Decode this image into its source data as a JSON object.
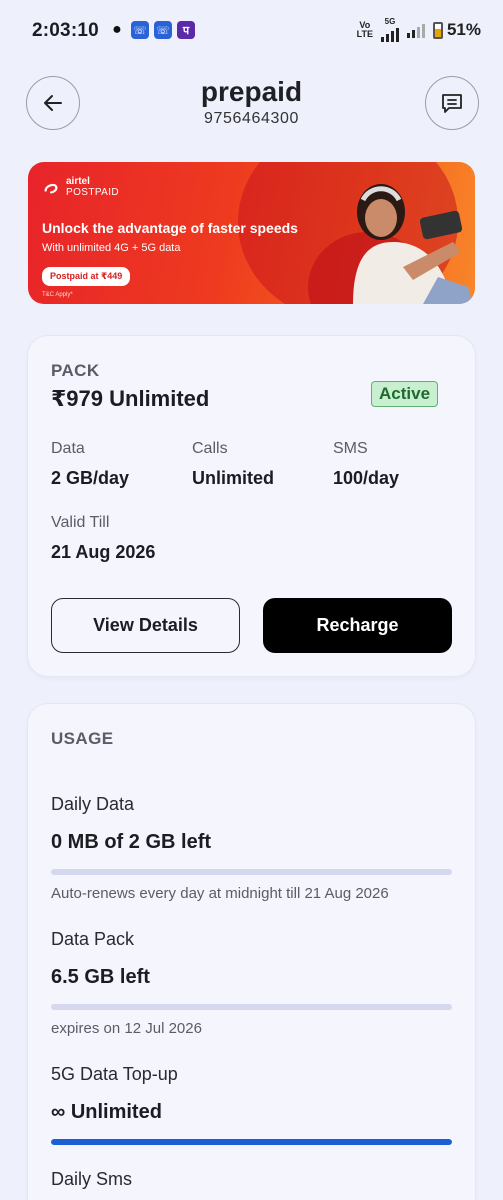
{
  "status_bar": {
    "time": "2:03:10",
    "volte": "Vo\nLTE",
    "network": "5G",
    "battery_percent": "51%",
    "battery_level": 0.51
  },
  "header": {
    "title": "prepaid",
    "number": "9756464300"
  },
  "banner": {
    "brand": "airtel",
    "brand_sub": "POSTPAID",
    "headline": "Unlock the advantage of faster speeds",
    "subline": "With unlimited 4G + 5G data",
    "pill": "Postpaid at ₹449",
    "tc": "T&C Apply*"
  },
  "pack": {
    "caption": "PACK",
    "name": "₹979 Unlimited",
    "status": "Active",
    "data_label": "Data",
    "data_value": "2 GB/day",
    "calls_label": "Calls",
    "calls_value": "Unlimited",
    "sms_label": "SMS",
    "sms_value": "100/day",
    "valid_label": "Valid Till",
    "valid_value": "21 Aug 2026",
    "view_details": "View Details",
    "recharge": "Recharge"
  },
  "usage": {
    "caption": "USAGE",
    "items": [
      {
        "title": "Daily Data",
        "value": "0 MB of 2 GB left",
        "note": "Auto-renews every day at midnight till 21 Aug 2026",
        "fill": 0
      },
      {
        "title": "Data Pack",
        "value": "6.5 GB left",
        "note": "expires on 12 Jul 2026",
        "fill": 0
      },
      {
        "title": "5G Data Top-up",
        "value": "∞ Unlimited",
        "note": "",
        "fill": 1
      },
      {
        "title": "Daily Sms",
        "value": "",
        "note": "",
        "fill": 0
      }
    ]
  },
  "colors": {
    "accent_blue": "#1b5fd6",
    "brand_red": "#e8242a",
    "active_green": "#c9efd1"
  }
}
